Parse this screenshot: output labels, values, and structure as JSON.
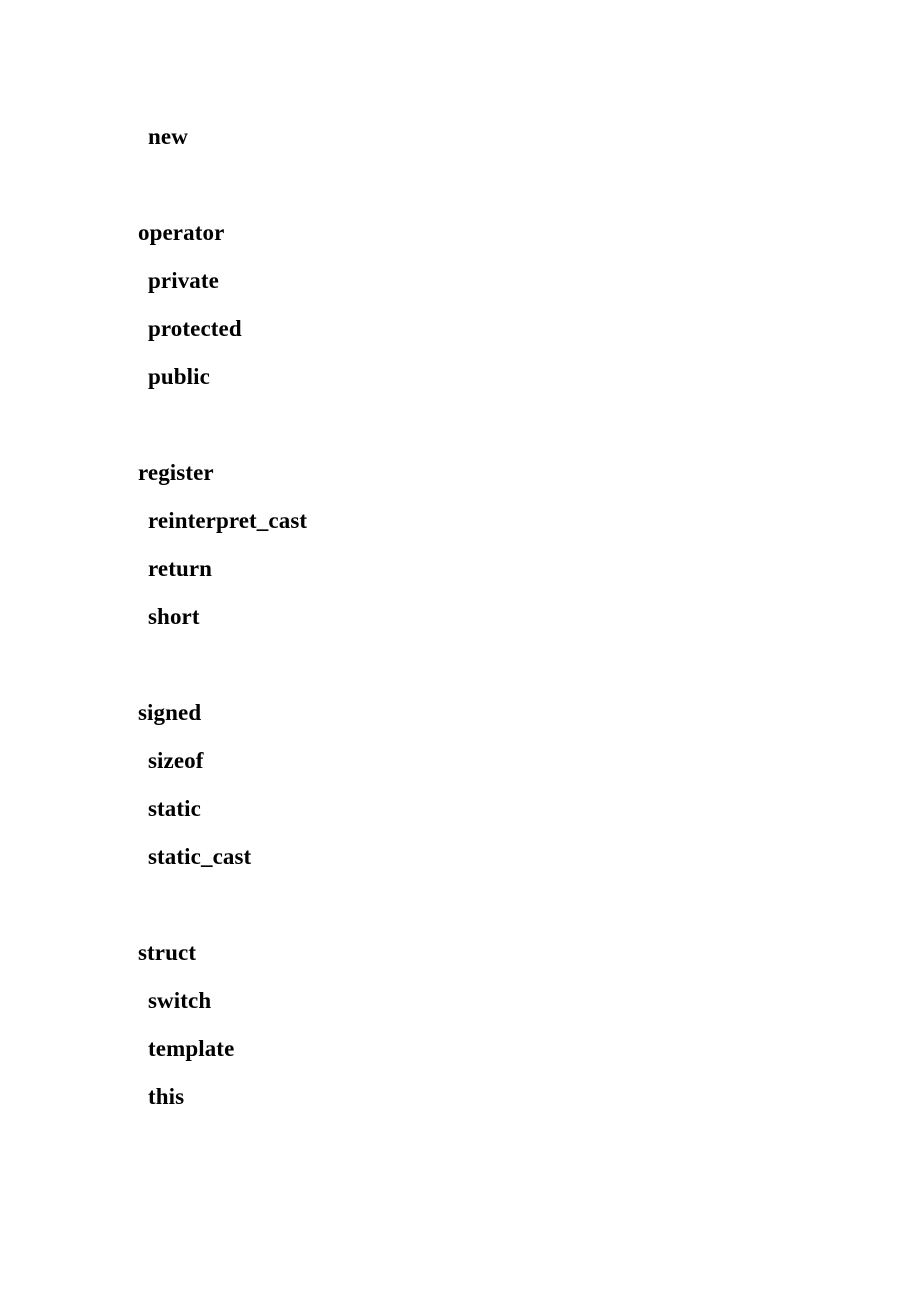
{
  "document": {
    "kind": "keyword-reference-list",
    "language_subject": "C++",
    "text_color": "#000000",
    "background_color": "#ffffff",
    "groups": [
      {
        "id": "group-new",
        "lines": [
          {
            "text": "new",
            "level": 1
          }
        ]
      },
      {
        "id": "group-operator",
        "lines": [
          {
            "text": "operator",
            "level": 0
          },
          {
            "text": "private",
            "level": 1
          },
          {
            "text": "protected",
            "level": 1
          },
          {
            "text": "public",
            "level": 1
          }
        ]
      },
      {
        "id": "group-register",
        "lines": [
          {
            "text": "register",
            "level": 0
          },
          {
            "text": "reinterpret_cast",
            "level": 1
          },
          {
            "text": "return",
            "level": 1
          },
          {
            "text": "short",
            "level": 1
          }
        ]
      },
      {
        "id": "group-signed",
        "lines": [
          {
            "text": "signed",
            "level": 0
          },
          {
            "text": "sizeof",
            "level": 1
          },
          {
            "text": "static",
            "level": 1
          },
          {
            "text": "static_cast",
            "level": 1
          }
        ]
      },
      {
        "id": "group-struct",
        "lines": [
          {
            "text": "struct",
            "level": 0
          },
          {
            "text": "switch",
            "level": 1
          },
          {
            "text": "template",
            "level": 1
          },
          {
            "text": "this",
            "level": 1
          }
        ]
      }
    ]
  }
}
